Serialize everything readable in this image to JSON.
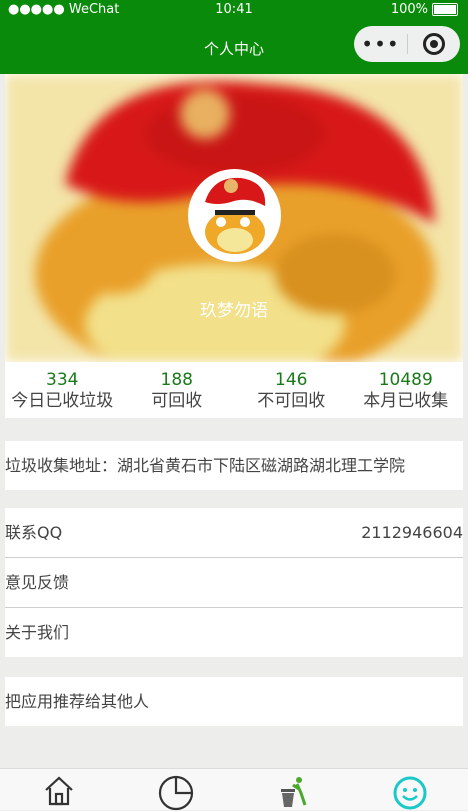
{
  "status_bar": {
    "carrier": "●●●●● WeChat",
    "time": "10:41",
    "battery": "100%"
  },
  "nav": {
    "title": "个人中心",
    "more_label": "•••"
  },
  "profile": {
    "nickname": "玖梦勿语"
  },
  "stats": [
    {
      "value": "334",
      "label": "今日已收垃圾"
    },
    {
      "value": "188",
      "label": "可回收"
    },
    {
      "value": "146",
      "label": "不可回收"
    },
    {
      "value": "10489",
      "label": "本月已收集"
    }
  ],
  "address": {
    "text": "垃圾收集地址：湖北省黄石市下陆区磁湖路湖北理工学院"
  },
  "menu": {
    "qq_label": "联系QQ",
    "qq_value": "2112946604",
    "feedback": "意见反馈",
    "about": "关于我们"
  },
  "share": {
    "label": "把应用推荐给其他人"
  },
  "tabbar": {
    "icons": [
      "home-icon",
      "pie-chart-icon",
      "trash-recycle-icon",
      "smiley-icon"
    ],
    "active_color": "#1bc8c8"
  },
  "colors": {
    "nav_bg": "#0a8a0a",
    "stat_number": "#1a7a1a"
  }
}
